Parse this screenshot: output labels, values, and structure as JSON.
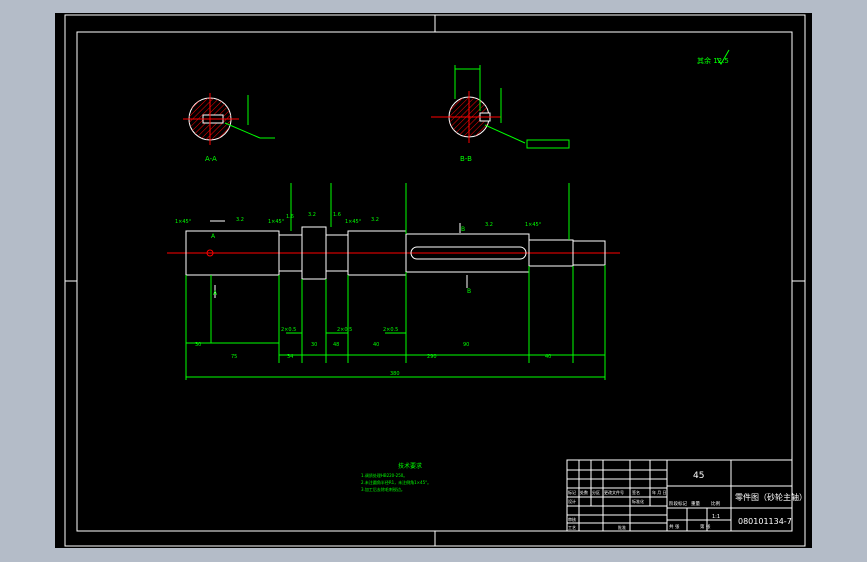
{
  "app": {
    "background_color": "#b4bcc8",
    "canvas_color": "#000000"
  },
  "colors": {
    "frame": "#ffffff",
    "geometry": "#ffffff",
    "dimension": "#00ff00",
    "centerline": "#ff0000",
    "hatch": "#ff0000"
  },
  "roughness_note": "其余 12.5",
  "section_a": {
    "label": "A-A"
  },
  "section_b": {
    "label": "B-B"
  },
  "shaft": {
    "chamfers": [
      "1×45°",
      "1×45°",
      "1×45°",
      "1×45°"
    ],
    "roughness": [
      "3.2",
      "1.6",
      "3.2",
      "1.6",
      "3.2",
      "3.2"
    ],
    "view_marks": [
      "A",
      "A",
      "B",
      "B"
    ],
    "segment_dims": [
      "30",
      "75",
      "34",
      "30",
      "48",
      "40",
      "290",
      "90",
      "40"
    ],
    "total_length": "380",
    "undercuts": [
      "2×0.5",
      "2×0.5",
      "2×0.5"
    ]
  },
  "technical_requirements": {
    "title": "技术要求",
    "lines": [
      "1.调质处理HB220-250。",
      "2.未注圆角半径R1，未注倒角1×45°。",
      "3.加工后去除毛刺锐边。"
    ]
  },
  "title_block": {
    "material": "45",
    "part_name": "零件图（砂轮主轴）",
    "drawing_number": "080101134-7",
    "scale": "1:1",
    "label_stage": "阶段标记",
    "label_weight": "重量",
    "label_scale": "比例",
    "label_sheets": "共 张",
    "label_sheet_no": "第 张",
    "label_marks": "标记",
    "label_count": "处数",
    "label_zone": "分区",
    "label_change_doc": "更改文件号",
    "label_signature": "签名",
    "label_date": "年 月 日",
    "label_designer": "设计",
    "label_standardization": "标准化",
    "label_checker": "审核",
    "label_process": "工艺",
    "label_approve": "批准"
  }
}
